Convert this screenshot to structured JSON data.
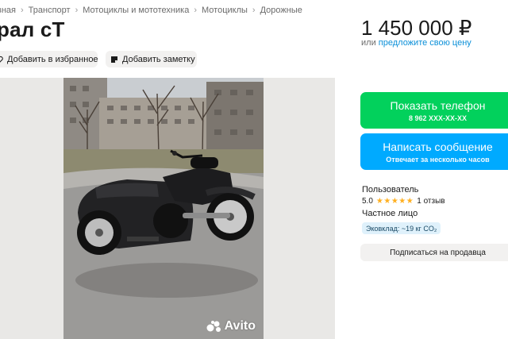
{
  "breadcrumbs": [
    "вная",
    "Транспорт",
    "Мотоциклы и мототехника",
    "Мотоциклы",
    "Дорожные"
  ],
  "listing": {
    "title": "рал сТ",
    "price": "1 450 000 ₽",
    "price_hint_prefix": "или",
    "price_hint_link": "предложите свою цену"
  },
  "actions": {
    "favorite_label": "Добавить в избранное",
    "note_label": "Добавить заметку"
  },
  "gallery": {
    "watermark": "Avito"
  },
  "contact": {
    "phone_label": "Показать телефон",
    "phone_number": "8 962 XXX-XX-XX",
    "message_label": "Написать сообщение",
    "message_sub": "Отвечает за несколько часов"
  },
  "seller": {
    "name": "Пользователь",
    "rating": "5.0",
    "stars": "★★★★★",
    "reviews": "1 отзыв",
    "type": "Частное лицо",
    "eco_badge": "Эковклад: ~19 кг CO₂",
    "subscribe_label": "Подписаться на продавца"
  },
  "colors": {
    "phone_button": "#02d15c",
    "message_button": "#00aaff",
    "link": "#0a8fd8",
    "stars": "#ffb021"
  }
}
